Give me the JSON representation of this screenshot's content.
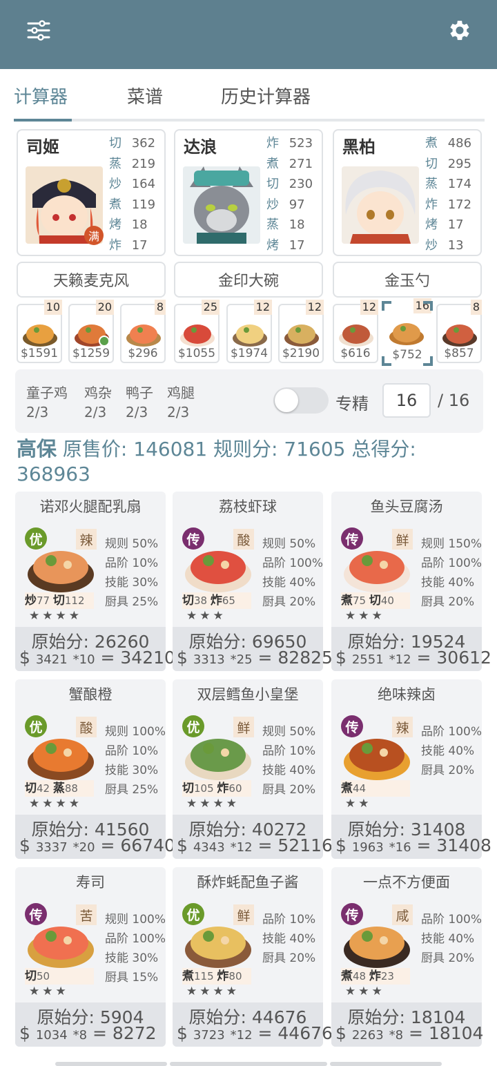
{
  "tabs": [
    "计算器",
    "菜谱",
    "历史计算器"
  ],
  "chefs": [
    {
      "name": "司姬",
      "badge": "满",
      "skills": [
        {
          "k": "切",
          "v": "362"
        },
        {
          "k": "蒸",
          "v": "219"
        },
        {
          "k": "炒",
          "v": "164"
        },
        {
          "k": "煮",
          "v": "119"
        },
        {
          "k": "烤",
          "v": "18"
        },
        {
          "k": "炸",
          "v": "17"
        }
      ]
    },
    {
      "name": "达浪",
      "badge": "",
      "skills": [
        {
          "k": "炸",
          "v": "523"
        },
        {
          "k": "煮",
          "v": "271"
        },
        {
          "k": "切",
          "v": "230"
        },
        {
          "k": "炒",
          "v": "97"
        },
        {
          "k": "蒸",
          "v": "18"
        },
        {
          "k": "烤",
          "v": "17"
        }
      ]
    },
    {
      "name": "黑柏",
      "badge": "",
      "skills": [
        {
          "k": "煮",
          "v": "486"
        },
        {
          "k": "切",
          "v": "295"
        },
        {
          "k": "蒸",
          "v": "174"
        },
        {
          "k": "炸",
          "v": "172"
        },
        {
          "k": "烤",
          "v": "17"
        },
        {
          "k": "炒",
          "v": "13"
        }
      ]
    }
  ],
  "tools": [
    "天籁麦克风",
    "金印大碗",
    "金玉勺"
  ],
  "dishes": [
    {
      "count": "10",
      "price": "$1591"
    },
    {
      "count": "20",
      "price": "$1259"
    },
    {
      "count": "8",
      "price": "$296"
    },
    {
      "count": "25",
      "price": "$1055"
    },
    {
      "count": "12",
      "price": "$1974"
    },
    {
      "count": "12",
      "price": "$2190"
    },
    {
      "count": "12",
      "price": "$616"
    },
    {
      "count": "16",
      "price": "$752"
    },
    {
      "count": "8",
      "price": "$857"
    }
  ],
  "materials": [
    {
      "name": "童子鸡",
      "value": "2/3"
    },
    {
      "name": "鸡杂",
      "value": "2/3"
    },
    {
      "name": "鸭子",
      "value": "2/3"
    },
    {
      "name": "鸡腿",
      "value": "2/3"
    }
  ],
  "filter": {
    "label": "专精",
    "level": "16",
    "max": "/ 16",
    "toggle_on": false
  },
  "summary": {
    "name": "高保",
    "text": "原售价: 146081 规则分: 71605 总得分: 368963"
  },
  "cards": [
    {
      "title": "诺邓火腿配乳扇",
      "rarity": "优",
      "flavor": "辣",
      "rules": [
        "规则 50%",
        "品阶 10%",
        "技能 30%",
        "厨具 25%"
      ],
      "skills": [
        {
          "k": "炒",
          "v": "77"
        },
        {
          "k": "切",
          "v": "112"
        }
      ],
      "stars": "★★★★",
      "orig": "原始分: 26260",
      "price": "3421",
      "mult": "*10",
      "total": "= 34210"
    },
    {
      "title": "荔枝虾球",
      "rarity": "传",
      "flavor": "酸",
      "rules": [
        "规则 50%",
        "品阶 100%",
        "技能 40%",
        "厨具 20%"
      ],
      "skills": [
        {
          "k": "切",
          "v": "38"
        },
        {
          "k": "炸",
          "v": "65"
        }
      ],
      "stars": "★★★",
      "orig": "原始分: 69650",
      "price": "3313",
      "mult": "*25",
      "total": "= 82825"
    },
    {
      "title": "鱼头豆腐汤",
      "rarity": "传",
      "flavor": "鲜",
      "rules": [
        "规则 150%",
        "品阶 100%",
        "技能 40%",
        "厨具 20%"
      ],
      "skills": [
        {
          "k": "煮",
          "v": "75"
        },
        {
          "k": "切",
          "v": "40"
        }
      ],
      "stars": "★★★",
      "orig": "原始分: 19524",
      "price": "2551",
      "mult": "*12",
      "total": "= 30612"
    },
    {
      "title": "蟹酿橙",
      "rarity": "优",
      "flavor": "酸",
      "rules": [
        "规则 100%",
        "品阶 10%",
        "技能 30%",
        "厨具 25%"
      ],
      "skills": [
        {
          "k": "切",
          "v": "42"
        },
        {
          "k": "蒸",
          "v": "88"
        }
      ],
      "stars": "★★★★",
      "orig": "原始分: 41560",
      "price": "3337",
      "mult": "*20",
      "total": "= 66740"
    },
    {
      "title": "双层鳕鱼小皇堡",
      "rarity": "优",
      "flavor": "鲜",
      "rules": [
        "规则 50%",
        "品阶 10%",
        "技能 40%",
        "厨具 20%"
      ],
      "skills": [
        {
          "k": "切",
          "v": "105"
        },
        {
          "k": "炸",
          "v": "60"
        }
      ],
      "stars": "★★★★",
      "orig": "原始分: 40272",
      "price": "4343",
      "mult": "*12",
      "total": "= 52116"
    },
    {
      "title": "绝味辣卤",
      "rarity": "传",
      "flavor": "辣",
      "rules": [
        "品阶 100%",
        "技能 40%",
        "厨具 20%"
      ],
      "skills": [
        {
          "k": "煮",
          "v": "44"
        }
      ],
      "stars": "★★",
      "orig": "原始分: 31408",
      "price": "1963",
      "mult": "*16",
      "total": "= 31408"
    },
    {
      "title": "寿司",
      "rarity": "传",
      "flavor": "苦",
      "rules": [
        "规则 100%",
        "品阶 100%",
        "技能 30%",
        "厨具 15%"
      ],
      "skills": [
        {
          "k": "切",
          "v": "50"
        }
      ],
      "stars": "★★★",
      "orig": "原始分: 5904",
      "price": "1034",
      "mult": "*8",
      "total": "= 8272"
    },
    {
      "title": "酥炸蚝配鱼子酱",
      "rarity": "优",
      "flavor": "鲜",
      "rules": [
        "品阶 10%",
        "技能 40%",
        "厨具 20%"
      ],
      "skills": [
        {
          "k": "煮",
          "v": "115"
        },
        {
          "k": "炸",
          "v": "80"
        }
      ],
      "stars": "★★★★",
      "orig": "原始分: 44676",
      "price": "3723",
      "mult": "*12",
      "total": "= 44676"
    },
    {
      "title": "一点不方便面",
      "rarity": "传",
      "flavor": "咸",
      "rules": [
        "品阶 100%",
        "技能 40%",
        "厨具 20%"
      ],
      "skills": [
        {
          "k": "煮",
          "v": "48"
        },
        {
          "k": "炸",
          "v": "23"
        }
      ],
      "stars": "★★★",
      "orig": "原始分: 18104",
      "price": "2263",
      "mult": "*8",
      "total": "= 18104"
    }
  ],
  "colors": {
    "header": "#5e808f",
    "accent": "#5d8696",
    "rarity_you": "#6a9a2a",
    "rarity_chuan": "#7a2e6e"
  },
  "icons": {
    "menu": "sliders-icon",
    "settings": "gear-icon"
  }
}
